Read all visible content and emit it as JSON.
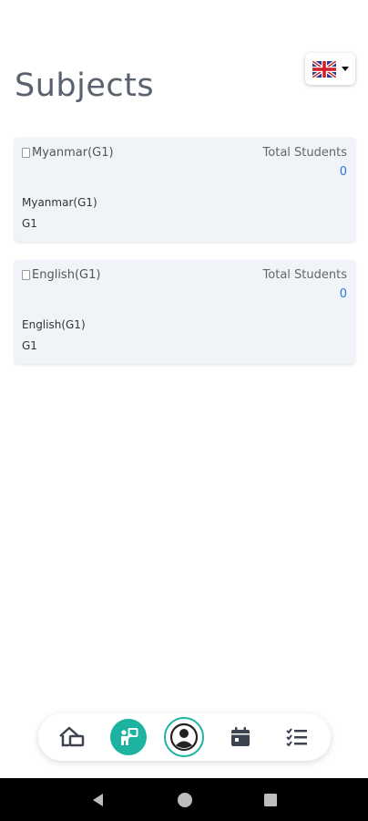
{
  "header": {
    "title": "Subjects",
    "language": {
      "selected": "English (UK)",
      "icon": "uk-flag-icon"
    }
  },
  "subjects": [
    {
      "image_alt": "Myanmar(G1)",
      "total_students_label": "Total Students",
      "total_students_value": "0",
      "name": "Myanmar(G1)",
      "grade": "G1"
    },
    {
      "image_alt": "English(G1)",
      "total_students_label": "Total Students",
      "total_students_value": "0",
      "name": "English(G1)",
      "grade": "G1"
    }
  ],
  "bottom_nav": {
    "items": [
      {
        "icon": "home-icon",
        "active": false
      },
      {
        "icon": "teacher-board-icon",
        "active": true
      },
      {
        "icon": "profile-icon",
        "active": false
      },
      {
        "icon": "calendar-icon",
        "active": false
      },
      {
        "icon": "checklist-icon",
        "active": false
      }
    ]
  },
  "colors": {
    "accent": "#1cb3a0",
    "link": "#2f78d6",
    "card_bg": "#f0f4f8",
    "title": "#5a6270"
  },
  "system_nav": {
    "icons": [
      "back-icon",
      "home-circle-icon",
      "recents-icon"
    ]
  }
}
